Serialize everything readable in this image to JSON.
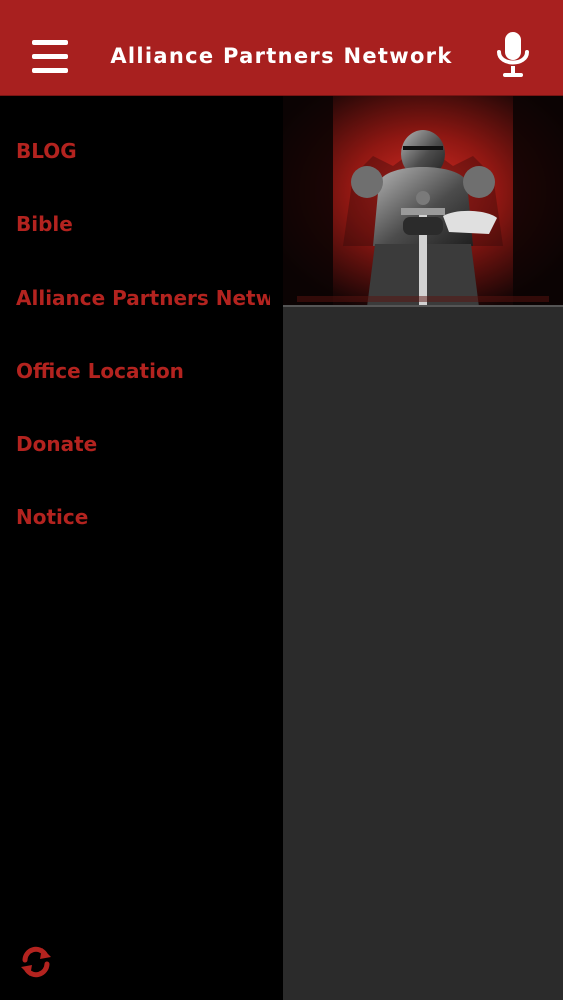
{
  "header": {
    "title": "Alliance Partners Network",
    "menu_icon": "hamburger-menu-icon",
    "mic_icon": "microphone-icon"
  },
  "drawer": {
    "items": [
      {
        "label": "BLOG"
      },
      {
        "label": "Bible"
      },
      {
        "label": "Alliance Partners Network"
      },
      {
        "label": "Office Location"
      },
      {
        "label": "Donate"
      },
      {
        "label": "Notice"
      }
    ],
    "refresh_icon": "refresh-icon"
  },
  "content": {
    "hero_icon": "knight-in-armor-image"
  },
  "colors": {
    "app_bar": "#a8201f",
    "drawer_bg": "#000000",
    "drawer_text": "#b3231f",
    "content_bg": "#2b2b2b"
  }
}
